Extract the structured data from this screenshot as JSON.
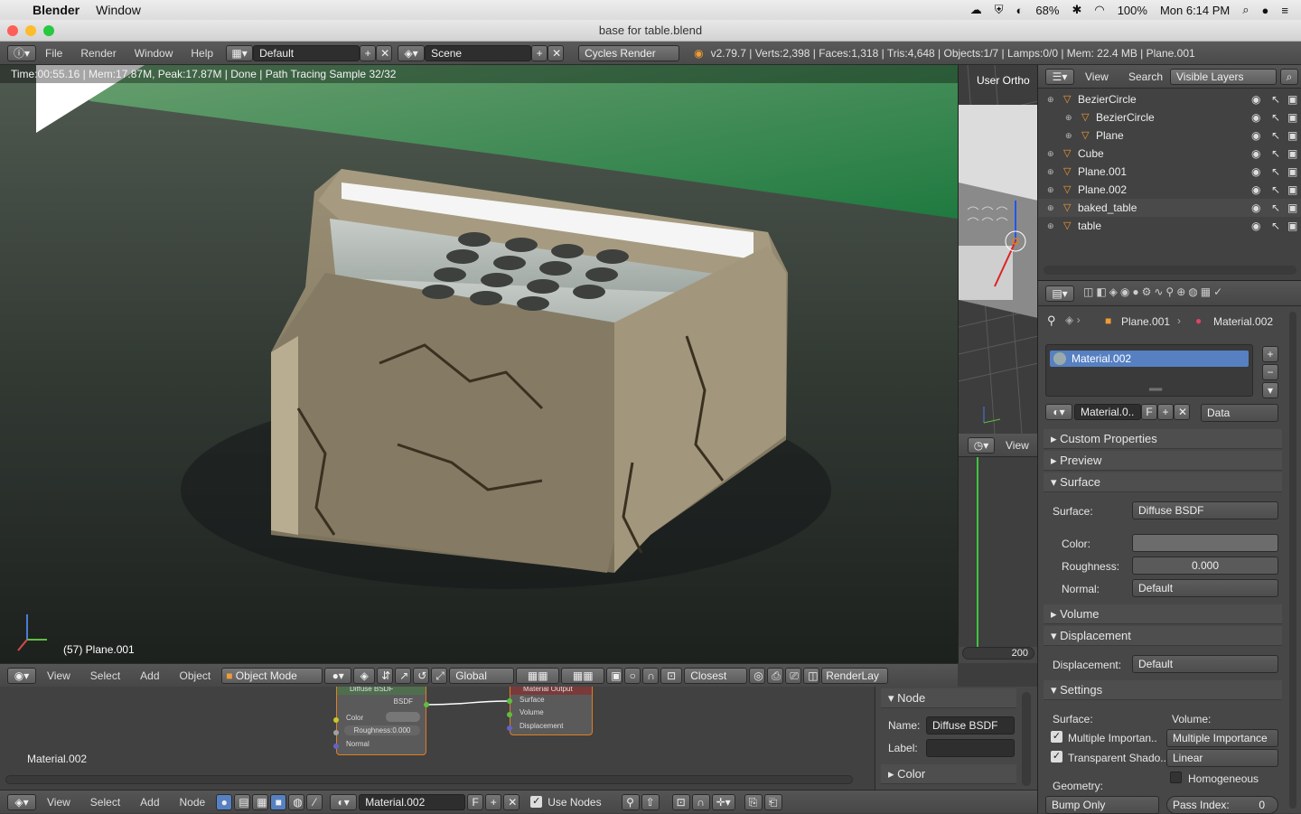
{
  "macbar": {
    "app_name": "Blender",
    "window_menu": "Window",
    "battery_percent_1": "68%",
    "battery_percent_2": "100%",
    "clock": "Mon 6:14 PM"
  },
  "window": {
    "title": "base for table.blend"
  },
  "infobar": {
    "menus": [
      "File",
      "Render",
      "Window",
      "Help"
    ],
    "layout": "Default",
    "scene": "Scene",
    "engine": "Cycles Render",
    "stats": "v2.79.7 | Verts:2,398 | Faces:1,318 | Tris:4,648 | Objects:1/7 | Lamps:0/0 | Mem: 22.4 MB | Plane.001"
  },
  "viewport": {
    "render_status": "Time:00:55.16 | Mem:17.87M, Peak:17.87M | Done | Path Tracing Sample 32/32",
    "object_label": "(57) Plane.001"
  },
  "view_header": {
    "menus": [
      "View",
      "Select",
      "Add",
      "Object"
    ],
    "mode": "Object Mode",
    "orientation": "Global",
    "snap": "Closest",
    "render_layer": "RenderLay"
  },
  "miniview": {
    "label": "User Ortho",
    "view_menu": "View"
  },
  "timeline": {
    "frame_end": "200"
  },
  "outliner": {
    "view": "View",
    "search": "Search",
    "filter": "Visible Layers",
    "items": [
      {
        "name": "BezierCircle",
        "indent": 0
      },
      {
        "name": "BezierCircle",
        "indent": 1
      },
      {
        "name": "Plane",
        "indent": 1
      },
      {
        "name": "Cube",
        "indent": 0
      },
      {
        "name": "Plane.001",
        "indent": 0
      },
      {
        "name": "Plane.002",
        "indent": 0
      },
      {
        "name": "baked_table",
        "indent": 0
      },
      {
        "name": "table",
        "indent": 0
      }
    ]
  },
  "props": {
    "breadcrumb_object": "Plane.001",
    "breadcrumb_material": "Material.002",
    "slot": "Material.002",
    "material_field": "Material.0..",
    "fake_user": "F",
    "link": "Data",
    "panels": {
      "custom_properties": "Custom Properties",
      "preview": "Preview",
      "surface": "Surface",
      "volume": "Volume",
      "displacement": "Displacement",
      "settings": "Settings"
    },
    "surface_label": "Surface:",
    "surface_value": "Diffuse BSDF",
    "color_label": "Color:",
    "roughness_label": "Roughness:",
    "roughness_value": "0.000",
    "normal_label": "Normal:",
    "normal_value": "Default",
    "displacement_label": "Displacement:",
    "displacement_value": "Default",
    "settings_surface": "Surface:",
    "settings_volume": "Volume:",
    "multiple_importance_check": "Multiple Importan..",
    "multiple_importance_dd": "Multiple Importance",
    "transparent_shadow": "Transparent Shado..",
    "volume_interp": "Linear",
    "homogeneous": "Homogeneous",
    "geometry": "Geometry:",
    "bump": "Bump Only",
    "pass_index_label": "Pass Index:",
    "pass_index_value": "0"
  },
  "node_editor": {
    "material_label": "Material.002",
    "node_diffuse": {
      "title": "Diffuse BSDF",
      "output": "BSDF",
      "color": "Color",
      "roughness": "Roughness:0.000",
      "normal": "Normal"
    },
    "node_output": {
      "title": "Material Output",
      "surface": "Surface",
      "volume": "Volume",
      "displacement": "Displacement"
    },
    "side": {
      "panel": "Node",
      "name_label": "Name:",
      "name_value": "Diffuse BSDF",
      "label_label": "Label:",
      "color_panel": "Color"
    }
  },
  "node_header": {
    "menus": [
      "View",
      "Select",
      "Add",
      "Node"
    ],
    "material": "Material.002",
    "fake_user": "F",
    "use_nodes": "Use Nodes"
  }
}
